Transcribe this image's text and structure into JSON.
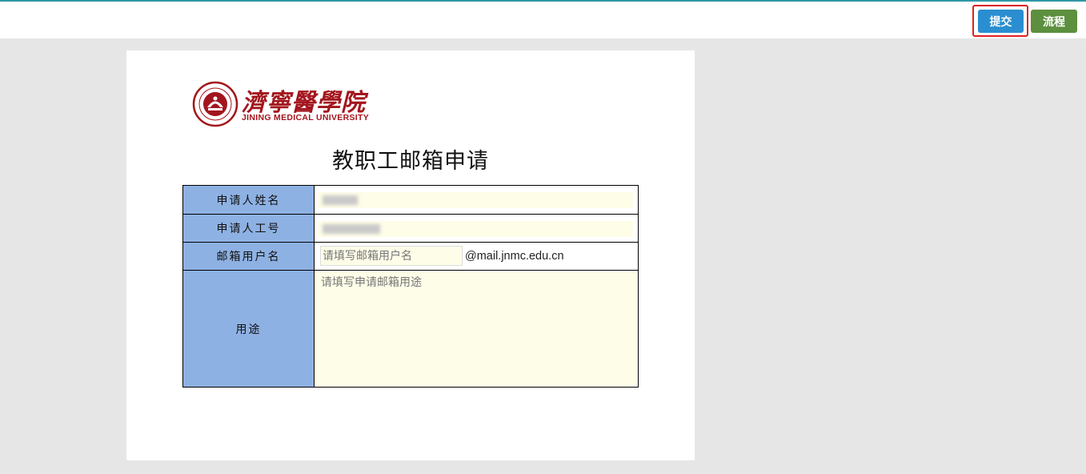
{
  "toolbar": {
    "submit_label": "提交",
    "flow_label": "流程"
  },
  "logo": {
    "name_cn": "濟寧醫學院",
    "name_en": "JINING MEDICAL UNIVERSITY"
  },
  "form": {
    "title": "教职工邮箱申请",
    "applicant_name_label": "申请人姓名",
    "applicant_id_label": "申请人工号",
    "username_label": "邮箱用户名",
    "username_placeholder": "请填写邮箱用户名",
    "email_domain": "@mail.jnmc.edu.cn",
    "purpose_label": "用途",
    "purpose_placeholder": "请填写申请邮箱用途"
  },
  "colors": {
    "submit_button": "#2a8ed0",
    "flow_button": "#5c8f3e",
    "label_cell": "#8eb1e3",
    "input_fill": "#fefde8",
    "brand_red": "#a3151d"
  }
}
